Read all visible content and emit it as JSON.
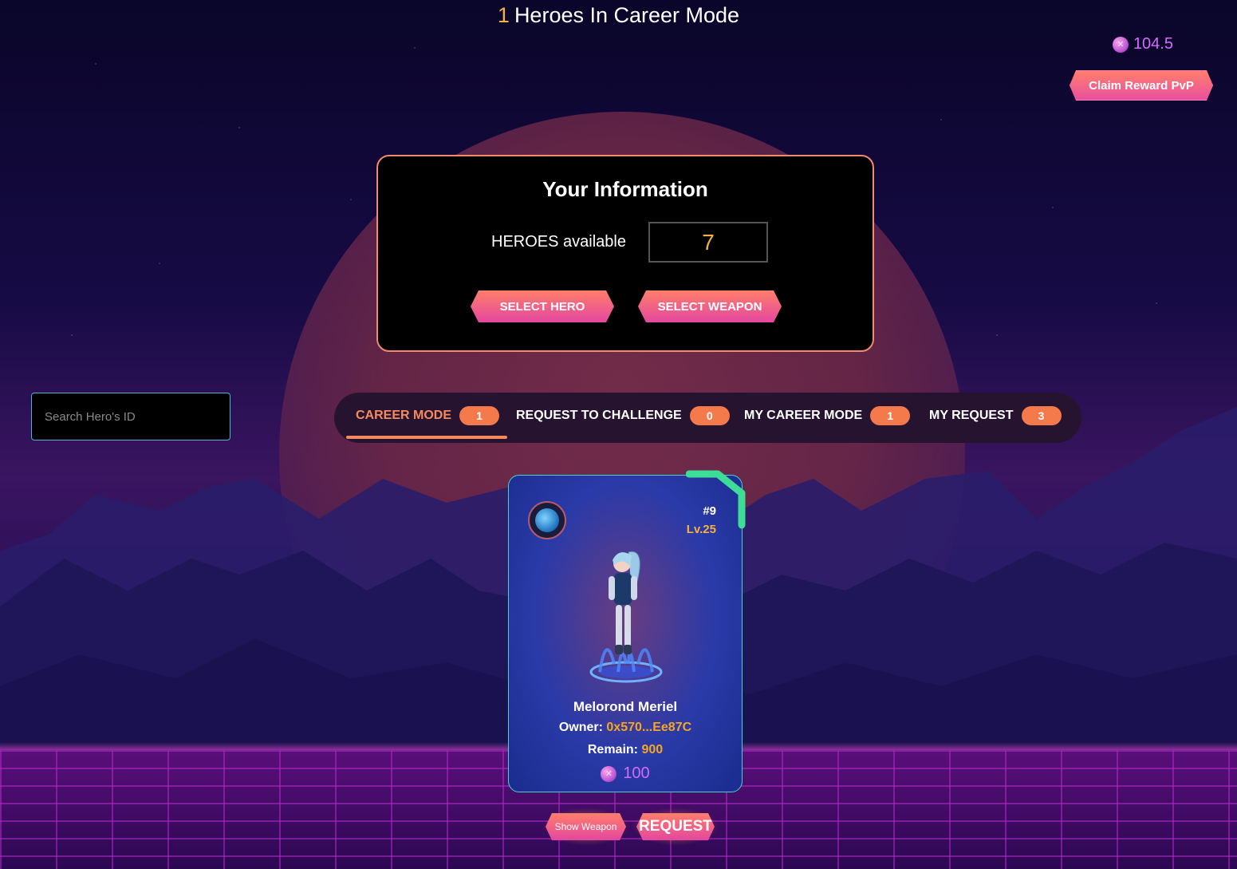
{
  "header": {
    "hero_count": "1",
    "title_suffix": "Heroes In Career Mode"
  },
  "wallet": {
    "balance": "104.5",
    "token_icon": "token-icon",
    "claim_label": "Claim Reward PvP"
  },
  "info": {
    "title": "Your Information",
    "heroes_label": "HEROES available",
    "heroes_value": "7",
    "select_hero_label": "SELECT HERO",
    "select_weapon_label": "SELECT WEAPON"
  },
  "search": {
    "placeholder": "Search Hero's ID"
  },
  "tabs": [
    {
      "label": "CAREER MODE",
      "count": "1",
      "active": true
    },
    {
      "label": "REQUEST TO CHALLENGE",
      "count": "0",
      "active": false
    },
    {
      "label": "MY CAREER MODE",
      "count": "1",
      "active": false
    },
    {
      "label": "MY REQUEST",
      "count": "3",
      "active": false
    }
  ],
  "hero_card": {
    "id": "#9",
    "level": "Lv.25",
    "name": "Melorond Meriel",
    "owner_label": "Owner:",
    "owner_value": "0x570...Ee87C",
    "remain_label": "Remain:",
    "remain_value": "900",
    "price": "100",
    "element_icon": "water-element-icon"
  },
  "actions": {
    "show_weapon_label": "Show Weapon",
    "request_label": "REQUEST"
  },
  "colors": {
    "accent_orange": "#f68a5f",
    "gold": "#f5b042",
    "token_purple": "#d46bff",
    "card_border": "#3fd6d0"
  }
}
